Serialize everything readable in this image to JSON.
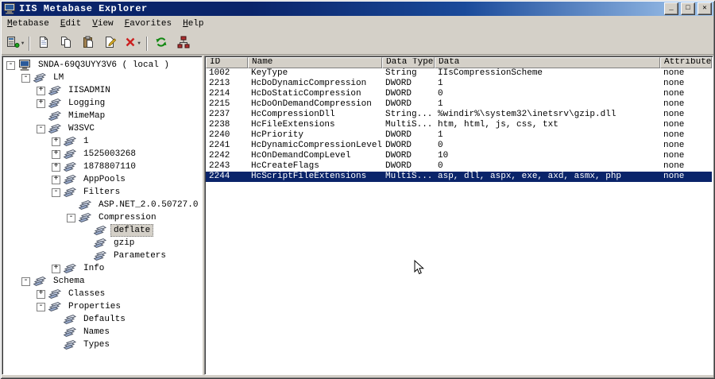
{
  "window": {
    "title": "IIS Metabase Explorer",
    "controls": {
      "minimize": "_",
      "maximize": "□",
      "close": "✕"
    }
  },
  "menu": {
    "items": [
      "Metabase",
      "Edit",
      "View",
      "Favorites",
      "Help"
    ]
  },
  "toolbar": {
    "items": [
      {
        "name": "connect-server",
        "icon": "server-icon",
        "dropdown": true
      },
      {
        "type": "separator"
      },
      {
        "name": "new-record",
        "icon": "new-record-icon"
      },
      {
        "name": "copy-record",
        "icon": "copy-icon"
      },
      {
        "name": "paste-record",
        "icon": "paste-icon"
      },
      {
        "name": "edit-record",
        "icon": "edit-record-icon"
      },
      {
        "name": "delete-record",
        "icon": "delete-icon",
        "dropdown": true
      },
      {
        "type": "separator"
      },
      {
        "name": "refresh",
        "icon": "refresh-icon"
      },
      {
        "name": "network-view",
        "icon": "network-icon"
      }
    ]
  },
  "tree": {
    "items": [
      {
        "level": 0,
        "toggle": "-",
        "icon": "computer-icon",
        "label": "SNDA-69Q3UYY3V6 ( local )"
      },
      {
        "level": 1,
        "toggle": "-",
        "icon": "key-icon",
        "label": "LM"
      },
      {
        "level": 2,
        "toggle": "+",
        "icon": "key-icon",
        "label": "IISADMIN"
      },
      {
        "level": 2,
        "toggle": "+",
        "icon": "key-icon",
        "label": "Logging"
      },
      {
        "level": 2,
        "toggle": "",
        "icon": "key-icon",
        "label": "MimeMap"
      },
      {
        "level": 2,
        "toggle": "-",
        "icon": "key-icon",
        "label": "W3SVC"
      },
      {
        "level": 3,
        "toggle": "+",
        "icon": "key-icon",
        "label": "1"
      },
      {
        "level": 3,
        "toggle": "+",
        "icon": "key-icon",
        "label": "1525003268"
      },
      {
        "level": 3,
        "toggle": "+",
        "icon": "key-icon",
        "label": "1878807110"
      },
      {
        "level": 3,
        "toggle": "+",
        "icon": "key-icon",
        "label": "AppPools"
      },
      {
        "level": 3,
        "toggle": "-",
        "icon": "key-icon",
        "label": "Filters"
      },
      {
        "level": 4,
        "toggle": "",
        "icon": "key-icon",
        "label": "ASP.NET_2.0.50727.0"
      },
      {
        "level": 4,
        "toggle": "-",
        "icon": "key-icon",
        "label": "Compression"
      },
      {
        "level": 5,
        "toggle": "",
        "icon": "key-icon",
        "label": "deflate",
        "selected": true
      },
      {
        "level": 5,
        "toggle": "",
        "icon": "key-icon",
        "label": "gzip"
      },
      {
        "level": 5,
        "toggle": "",
        "icon": "key-icon",
        "label": "Parameters"
      },
      {
        "level": 3,
        "toggle": "+",
        "icon": "key-icon",
        "label": "Info"
      },
      {
        "level": 1,
        "toggle": "-",
        "icon": "key-icon",
        "label": "Schema"
      },
      {
        "level": 2,
        "toggle": "+",
        "icon": "key-icon",
        "label": "Classes"
      },
      {
        "level": 2,
        "toggle": "-",
        "icon": "key-icon",
        "label": "Properties"
      },
      {
        "level": 3,
        "toggle": "",
        "icon": "key-icon",
        "label": "Defaults"
      },
      {
        "level": 3,
        "toggle": "",
        "icon": "key-icon",
        "label": "Names"
      },
      {
        "level": 3,
        "toggle": "",
        "icon": "key-icon",
        "label": "Types"
      }
    ]
  },
  "table": {
    "columns": [
      "ID",
      "Name",
      "Data Type",
      "Data",
      "Attributes"
    ],
    "selected_id": "2244",
    "rows": [
      [
        "1002",
        "KeyType",
        "String",
        "IIsCompressionScheme",
        "none"
      ],
      [
        "2213",
        "HcDoDynamicCompression",
        "DWORD",
        "1",
        "none"
      ],
      [
        "2214",
        "HcDoStaticCompression",
        "DWORD",
        "0",
        "none"
      ],
      [
        "2215",
        "HcDoOnDemandCompression",
        "DWORD",
        "1",
        "none"
      ],
      [
        "2237",
        "HcCompressionDll",
        "String...",
        "%windir%\\system32\\inetsrv\\gzip.dll",
        "none"
      ],
      [
        "2238",
        "HcFileExtensions",
        "MultiS...",
        "htm, html, js, css, txt",
        "none"
      ],
      [
        "2240",
        "HcPriority",
        "DWORD",
        "1",
        "none"
      ],
      [
        "2241",
        "HcDynamicCompressionLevel",
        "DWORD",
        "0",
        "none"
      ],
      [
        "2242",
        "HcOnDemandCompLevel",
        "DWORD",
        "10",
        "none"
      ],
      [
        "2243",
        "HcCreateFlags",
        "DWORD",
        "0",
        "none"
      ],
      [
        "2244",
        "HcScriptFileExtensions",
        "MultiS...",
        "asp, dll, aspx, exe, axd, asmx, php",
        "none"
      ]
    ]
  },
  "colors": {
    "selection": "#0a246a",
    "chrome": "#d4d0c8",
    "titlebar_start": "#0a246a",
    "titlebar_end": "#a6caf0"
  }
}
